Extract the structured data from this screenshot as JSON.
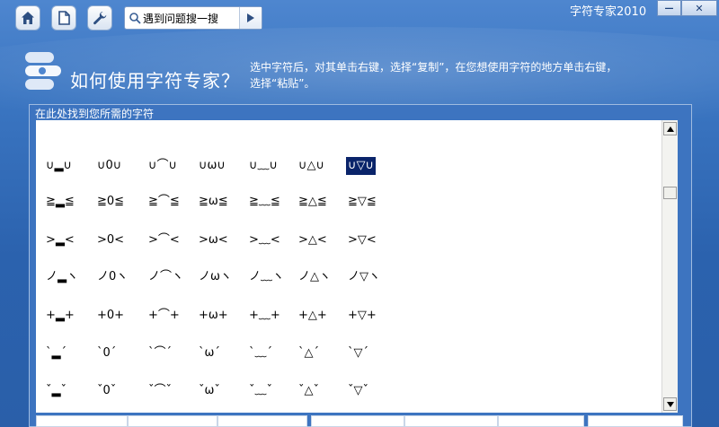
{
  "window": {
    "title": "字符专家2010",
    "minimize_glyph": "—",
    "close_glyph": "✕"
  },
  "toolbar": {
    "buttons": [
      {
        "name": "home-icon"
      },
      {
        "name": "document-icon"
      },
      {
        "name": "wrench-icon"
      }
    ],
    "search": {
      "value": "遇到问题搜一搜",
      "go_icon": "play-arrow-icon"
    }
  },
  "header": {
    "title": "如何使用字符专家？",
    "instructions": "选中字符后，对其单击右键，选择“复制”，在您想使用字符的地方单击右键，选择“粘贴”。"
  },
  "panel": {
    "label": "在此处找到您所需的字符",
    "rows": [
      [
        "∪▂∪",
        "∪0∪",
        "∪⌒∪",
        "∪ω∪",
        "∪﹏∪",
        "∪△∪",
        "∪▽∪"
      ],
      [
        "≧▂≦",
        "≧0≦",
        "≧⌒≦",
        "≧ω≦",
        "≧﹏≦",
        "≧△≦",
        "≧▽≦"
      ],
      [
        ">▂<",
        ">0<",
        ">⌒<",
        ">ω<",
        ">﹏<",
        ">△<",
        ">▽<"
      ],
      [
        "ノ▂ヽ",
        "ノ0ヽ",
        "ノ⌒ヽ",
        "ノωヽ",
        "ノ﹏ヽ",
        "ノ△ヽ",
        "ノ▽ヽ"
      ],
      [
        "+▂+",
        "+0+",
        "+⌒+",
        "+ω+",
        "+﹏+",
        "+△+",
        "+▽+"
      ],
      [
        "`▂´",
        "`0´",
        "`⌒´",
        "`ω´",
        "`﹏´",
        "`△´",
        "`▽´"
      ],
      [
        "ˇ▂ˇ",
        "ˇ0ˇ",
        "ˇ⌒ˇ",
        "ˇωˇ",
        "ˇ﹏ˇ",
        "ˇ△ˇ",
        "ˇ▽ˇ"
      ]
    ],
    "selected": {
      "row": 0,
      "col": 6
    }
  },
  "colors": {
    "accent": "#2b62ae",
    "selection": "#0a246a"
  }
}
